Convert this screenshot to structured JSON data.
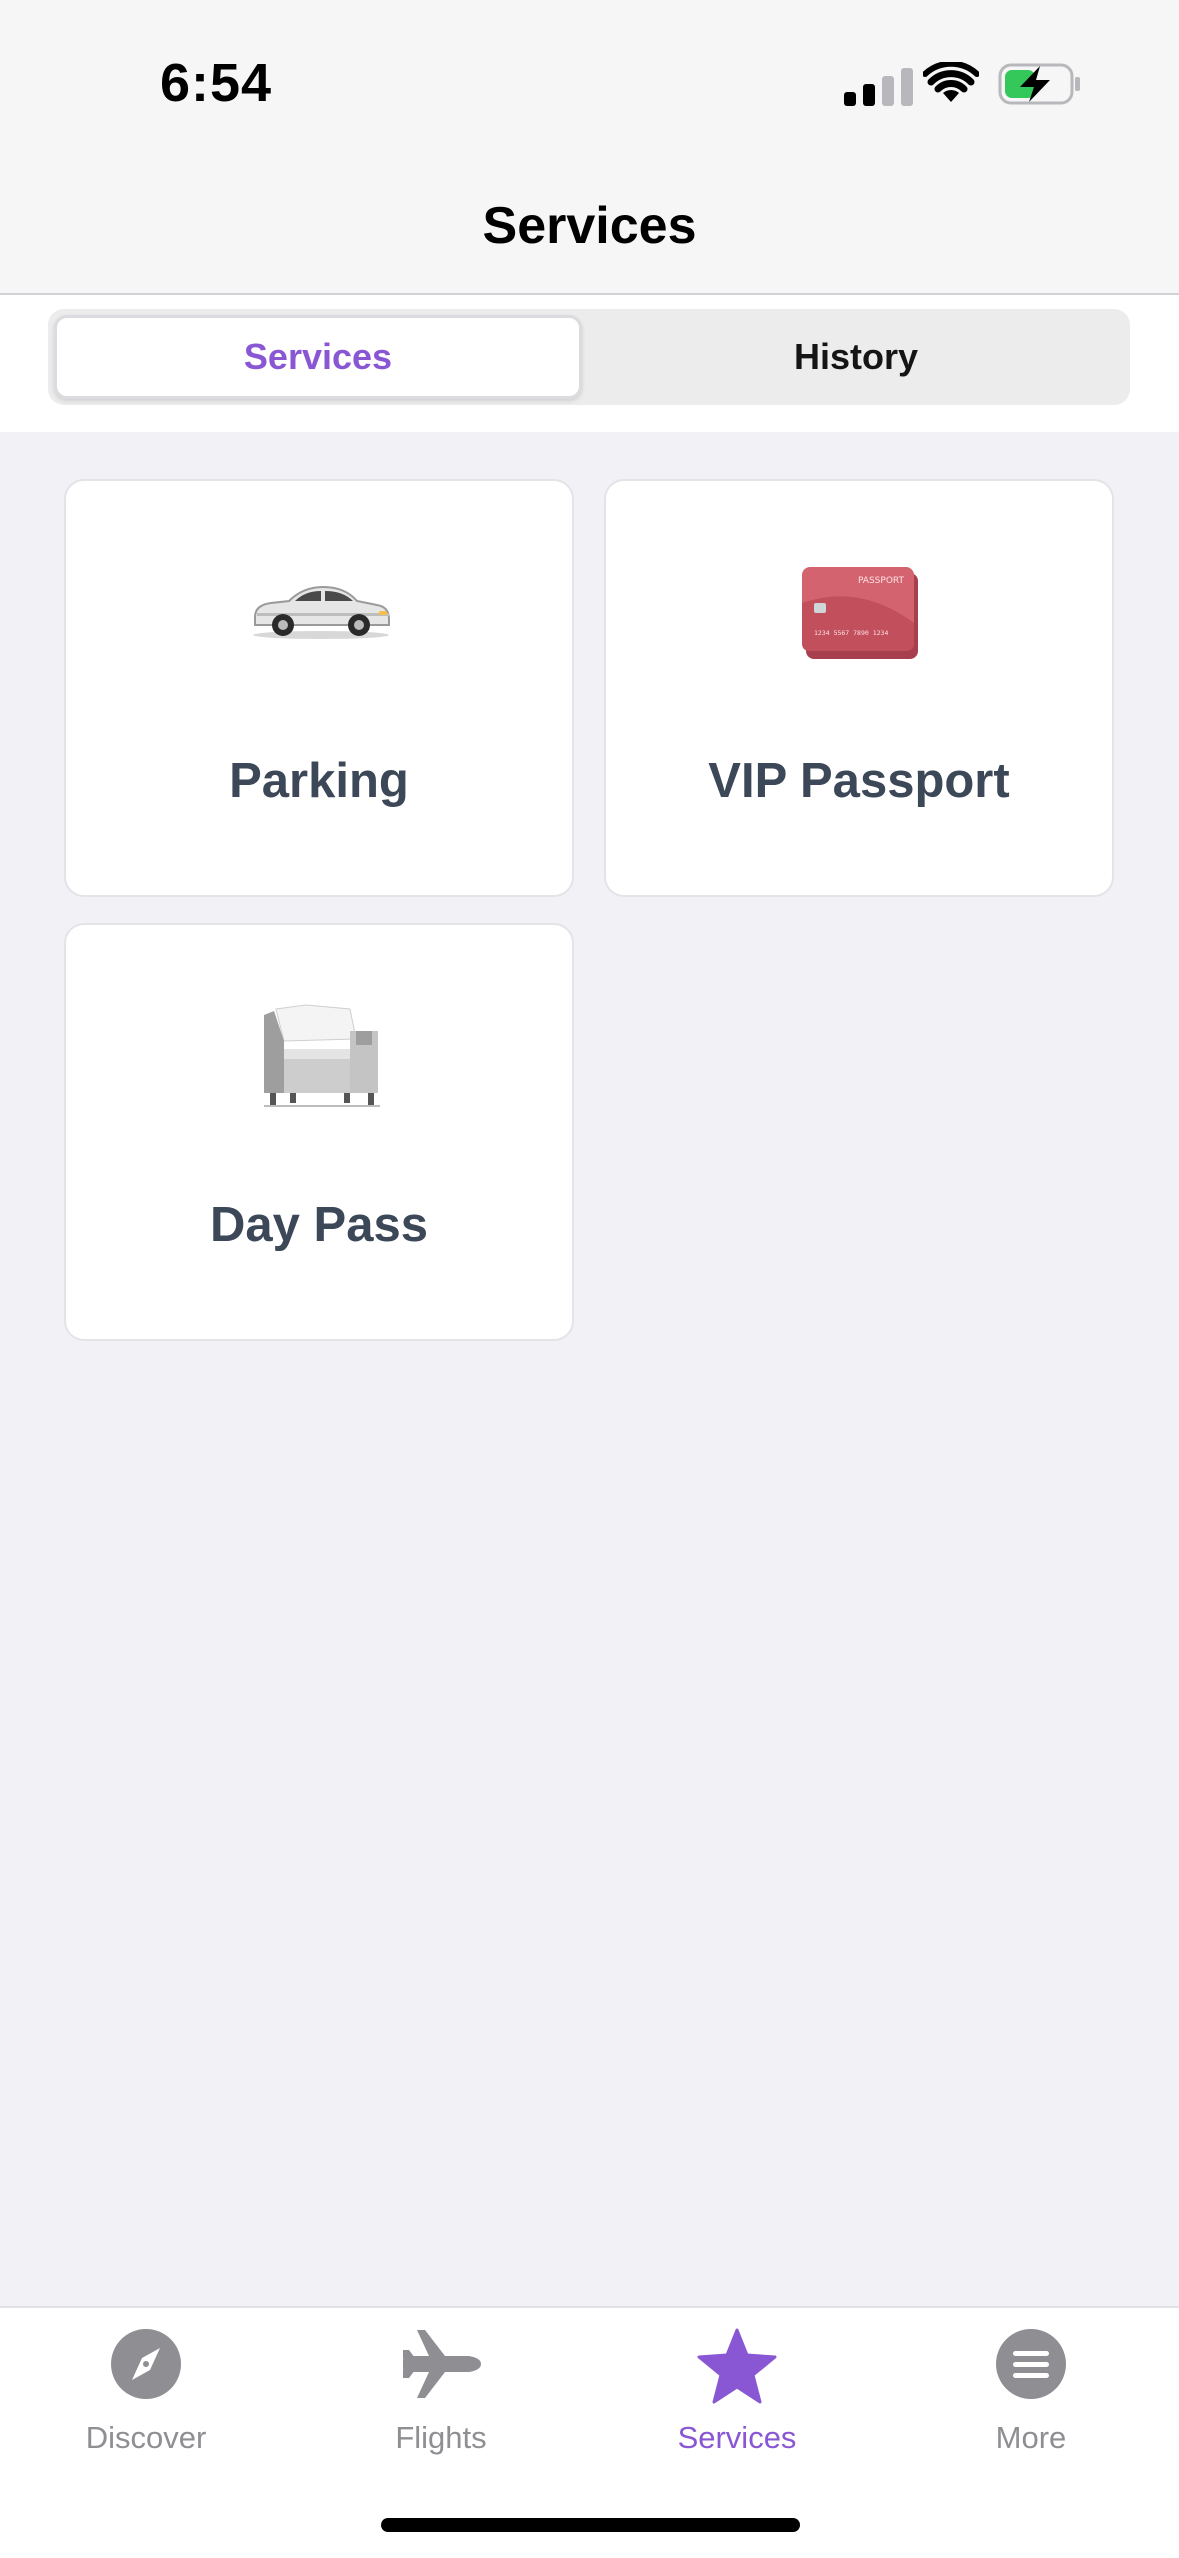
{
  "status_bar": {
    "time": "6:54"
  },
  "header": {
    "title": "Services"
  },
  "segments": [
    {
      "label": "Services",
      "active": true
    },
    {
      "label": "History",
      "active": false
    }
  ],
  "cards": [
    {
      "label": "Parking",
      "icon": "car-icon"
    },
    {
      "label": "VIP Passport",
      "icon": "passport-card-icon",
      "card_text": {
        "title": "PASSPORT",
        "number": "1234 5567 7890 1234"
      }
    },
    {
      "label": "Day Pass",
      "icon": "armchair-icon"
    }
  ],
  "tabbar": {
    "items": [
      {
        "label": "Discover",
        "icon": "compass-icon",
        "active": false
      },
      {
        "label": "Flights",
        "icon": "airplane-icon",
        "active": false
      },
      {
        "label": "Services",
        "icon": "star-icon",
        "active": true
      },
      {
        "label": "More",
        "icon": "menu-icon",
        "active": false
      }
    ]
  },
  "colors": {
    "accent": "#8a57d4",
    "inactive": "#8e8e93",
    "card_label": "#3c4858",
    "background": "#f1f1f6"
  }
}
